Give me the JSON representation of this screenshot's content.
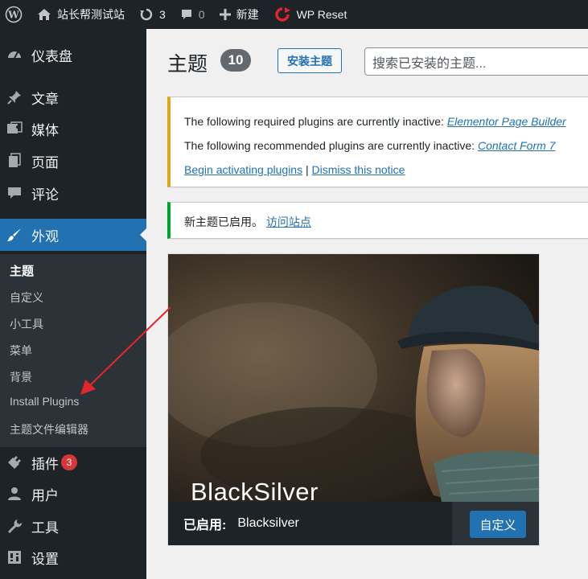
{
  "adminbar": {
    "site_name": "站长帮测试站",
    "updates_count": "3",
    "comments_count": "0",
    "new_label": "新建",
    "wp_reset_label": "WP Reset"
  },
  "sidebar": {
    "dashboard": "仪表盘",
    "posts": "文章",
    "media": "媒体",
    "pages": "页面",
    "comments": "评论",
    "appearance": "外观",
    "plugins": "插件",
    "plugins_badge": "3",
    "users": "用户",
    "tools": "工具",
    "settings": "设置",
    "submenu": [
      "主题",
      "自定义",
      "小工具",
      "菜单",
      "背景",
      "Install Plugins",
      "主题文件编辑器"
    ]
  },
  "main": {
    "title": "主题",
    "count": "10",
    "add_button": "安装主题",
    "search_placeholder": "搜索已安装的主题..."
  },
  "notice_warning": {
    "line1_text": "The following required plugins are currently inactive:",
    "line1_link": "Elementor Page Builder",
    "line2_text": "The following recommended plugins are currently inactive:",
    "line2_link": "Contact Form 7",
    "begin_link": "Begin activating plugins",
    "separator": "|",
    "dismiss_link": "Dismiss this notice"
  },
  "notice_success": {
    "text": "新主题已启用。",
    "link": "访问站点"
  },
  "theme": {
    "art_name": "BlackSilver",
    "active_label": "已启用:",
    "name": "Blacksilver",
    "customize_button": "自定义"
  },
  "colors": {
    "adminbar": "#1d2327",
    "accent": "#2271b1",
    "warning": "#dba617",
    "success": "#00a32a",
    "badge": "#d63638",
    "annotation_arrow": "#e0272d"
  }
}
